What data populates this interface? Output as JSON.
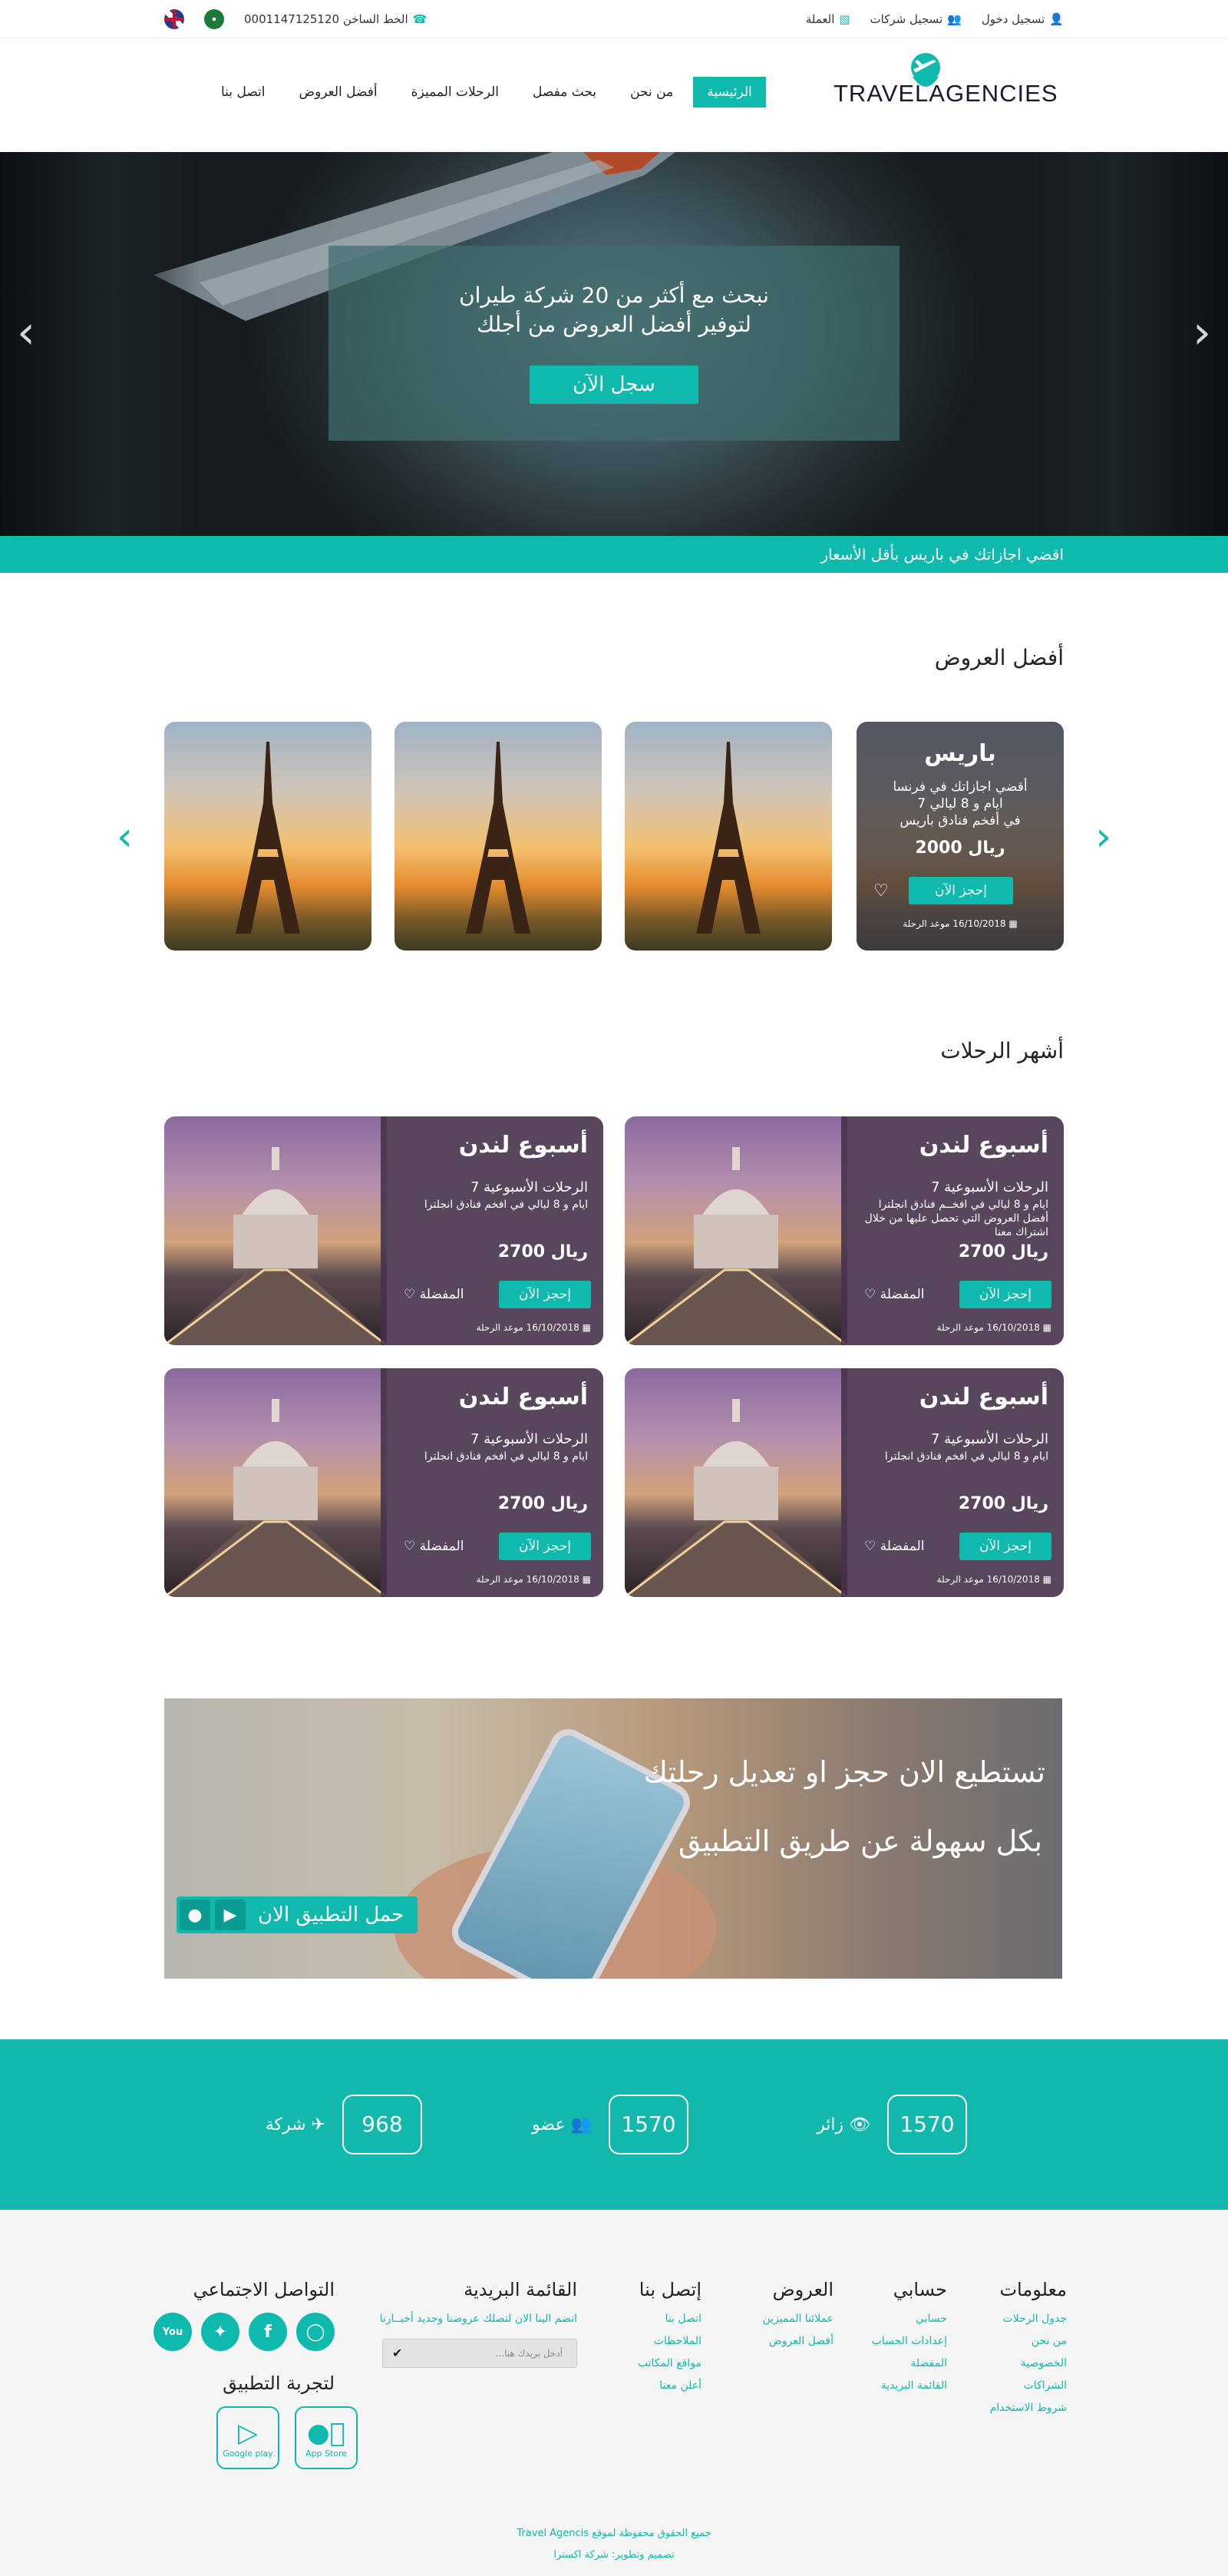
{
  "topbar": {
    "login": "تسجيل دخول",
    "company_signup": "تسجيل شركات",
    "currency": "العملة",
    "hotline": "الخط الساخن 0001147125120"
  },
  "nav": {
    "items": [
      "الرئيسية",
      "من نحن",
      "بحث مفصل",
      "الرحلات المميزة",
      "أفضل العروض",
      "اتصل بنا"
    ]
  },
  "logo": {
    "text": "TRAVELAGENCIES"
  },
  "hero": {
    "line1": "نبحث مع أكثر من 20 شركة طيران",
    "line2": "لتوفير أفضل العروض من أجلك",
    "cta": "سجل الآن"
  },
  "ticker": {
    "text": "اقضي اجازاتك في باريس بأقل الأسعار"
  },
  "offers": {
    "title": "أفضل العروض",
    "featured": {
      "city": "باريس",
      "desc1": "أقضي اجازاتك في فرنسا",
      "desc2": "ايام و 8 ليالي 7",
      "desc3": "في أفخم فنادق باريس",
      "price": "ريال 2000",
      "book": "إحجز الآن",
      "date": "16/10/2018 موعد الرحلة"
    }
  },
  "trips": {
    "title": "أشهر الرحلات",
    "cards": [
      {
        "title": "أسبوع لندن",
        "sub": "الرحلات الأسبوعية 7",
        "l1": "ايام و 8 ليالي في افخــم فنادق انجلترا",
        "l2": "أفضل العروض التي تحصل عليها من خلال",
        "l3": "اشتراك معنا",
        "price": "ريال 2700",
        "book": "إحجز الآن",
        "fav": "المفضلة",
        "date": "16/10/2018 موعد الرحلة"
      },
      {
        "title": "أسبوع لندن",
        "sub": "الرحلات الأسبوعية 7",
        "l1": "ايام و 8 ليالي في افخم فنادق انجلترا",
        "l2": "",
        "l3": "",
        "price": "ريال 2700",
        "book": "إحجز الآن",
        "fav": "المفضلة",
        "date": "16/10/2018 موعد الرحلة"
      },
      {
        "title": "أسبوع لندن",
        "sub": "الرحلات الأسبوعية 7",
        "l1": "ايام و 8 ليالي في افخم فنادق انجلترا",
        "l2": "",
        "l3": "",
        "price": "ريال 2700",
        "book": "إحجز الآن",
        "fav": "المفضلة",
        "date": "16/10/2018 موعد الرحلة"
      },
      {
        "title": "أسبوع لندن",
        "sub": "الرحلات الأسبوعية 7",
        "l1": "ايام و 8 ليالي في افخم فنادق انجلترا",
        "l2": "",
        "l3": "",
        "price": "ريال 2700",
        "book": "إحجز الآن",
        "fav": "المفضلة",
        "date": "16/10/2018 موعد الرحلة"
      }
    ]
  },
  "app": {
    "line1": "تستطيع الان حجز او تعديل رحلتك",
    "line2": "بكل سهولة عن طريق التطبيق",
    "download": "حمل التطبيق الان"
  },
  "stats": [
    {
      "value": "1570",
      "label": "زائر"
    },
    {
      "value": "1570",
      "label": "عضو"
    },
    {
      "value": "968",
      "label": "شركة"
    }
  ],
  "footer": {
    "info": {
      "title": "معلومات",
      "links": [
        "جدول الرحلات",
        "من نحن",
        "الخصوصية",
        "الشراكات",
        "شروط الاستخدام"
      ]
    },
    "account": {
      "title": "حسابي",
      "links": [
        "حسابي",
        "إعدادات الحساب",
        "المفضلة",
        "القائمة البريدية"
      ]
    },
    "offers": {
      "title": "العروض",
      "links": [
        "عملائنا المميزين",
        "أفضل العروض"
      ]
    },
    "contact": {
      "title": "إتصل بنا",
      "links": [
        "اتصل بنا",
        "الملاحظات",
        "مواقع المكاتب",
        "أعلن معنا"
      ]
    },
    "newsletter": {
      "title": "القائمة البريدية",
      "text": "انضم الينا الان لتصلك عروضنا وجديد أخبــارنا",
      "placeholder": "أدخل بريدك هنا..."
    },
    "social": {
      "title": "التواصل الاجتماعي",
      "app_title": "لتجربة التطبيق",
      "google": "Google play",
      "apple": "App Store"
    },
    "copyright": "جميع الحقوق محفوظة لموقع Travel Agencis",
    "design": "تصميم وتطوير: شركة اكسترا"
  },
  "colors": {
    "accent": "#0fb9ad"
  }
}
